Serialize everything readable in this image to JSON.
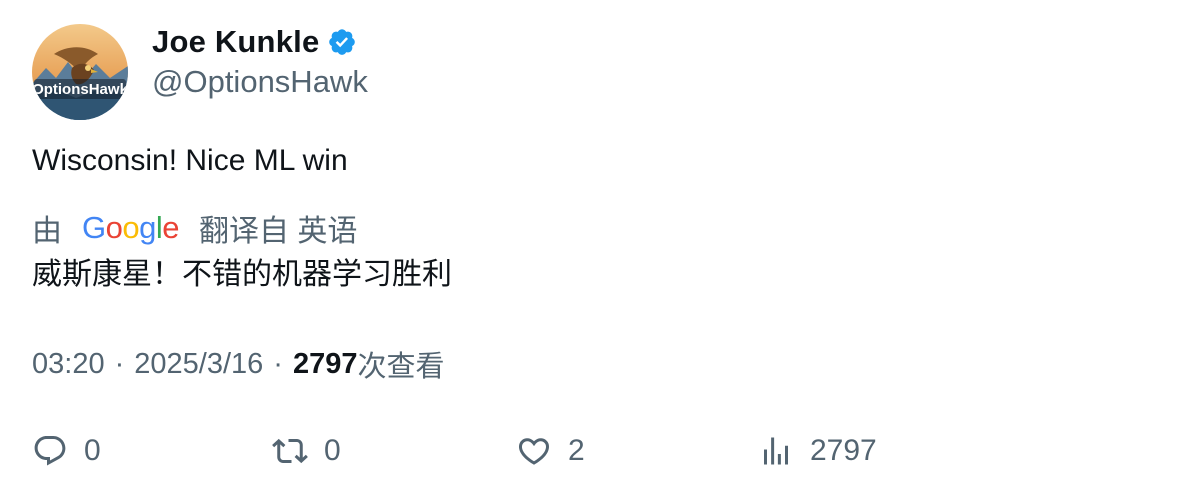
{
  "author": {
    "display_name": "Joe Kunkle",
    "handle": "@OptionsHawk",
    "avatar_text": "OptionsHawk",
    "verified_color": "#1d9bf0"
  },
  "tweet": {
    "text": "Wisconsin! Nice ML win",
    "translation": {
      "prefix": "由",
      "provider": "Google",
      "suffix": "翻译自 英语",
      "text": "威斯康星！不错的机器学习胜利"
    },
    "meta": {
      "time": "03:20",
      "separator": "·",
      "date": "2025/3/16",
      "views_count": "2797",
      "views_label": "次查看"
    }
  },
  "actions": {
    "reply_count": "0",
    "retweet_count": "0",
    "like_count": "2",
    "views_count": "2797"
  },
  "icons": {
    "verified": "verified-badge-icon",
    "reply": "reply-icon",
    "retweet": "retweet-icon",
    "like": "heart-icon",
    "views": "analytics-icon"
  },
  "colors": {
    "text_primary": "#0f1419",
    "text_secondary": "#536471",
    "accent": "#1d9bf0",
    "google_blue": "#4285F4",
    "google_red": "#EA4335",
    "google_yellow": "#FBBC05",
    "google_green": "#34A853"
  }
}
